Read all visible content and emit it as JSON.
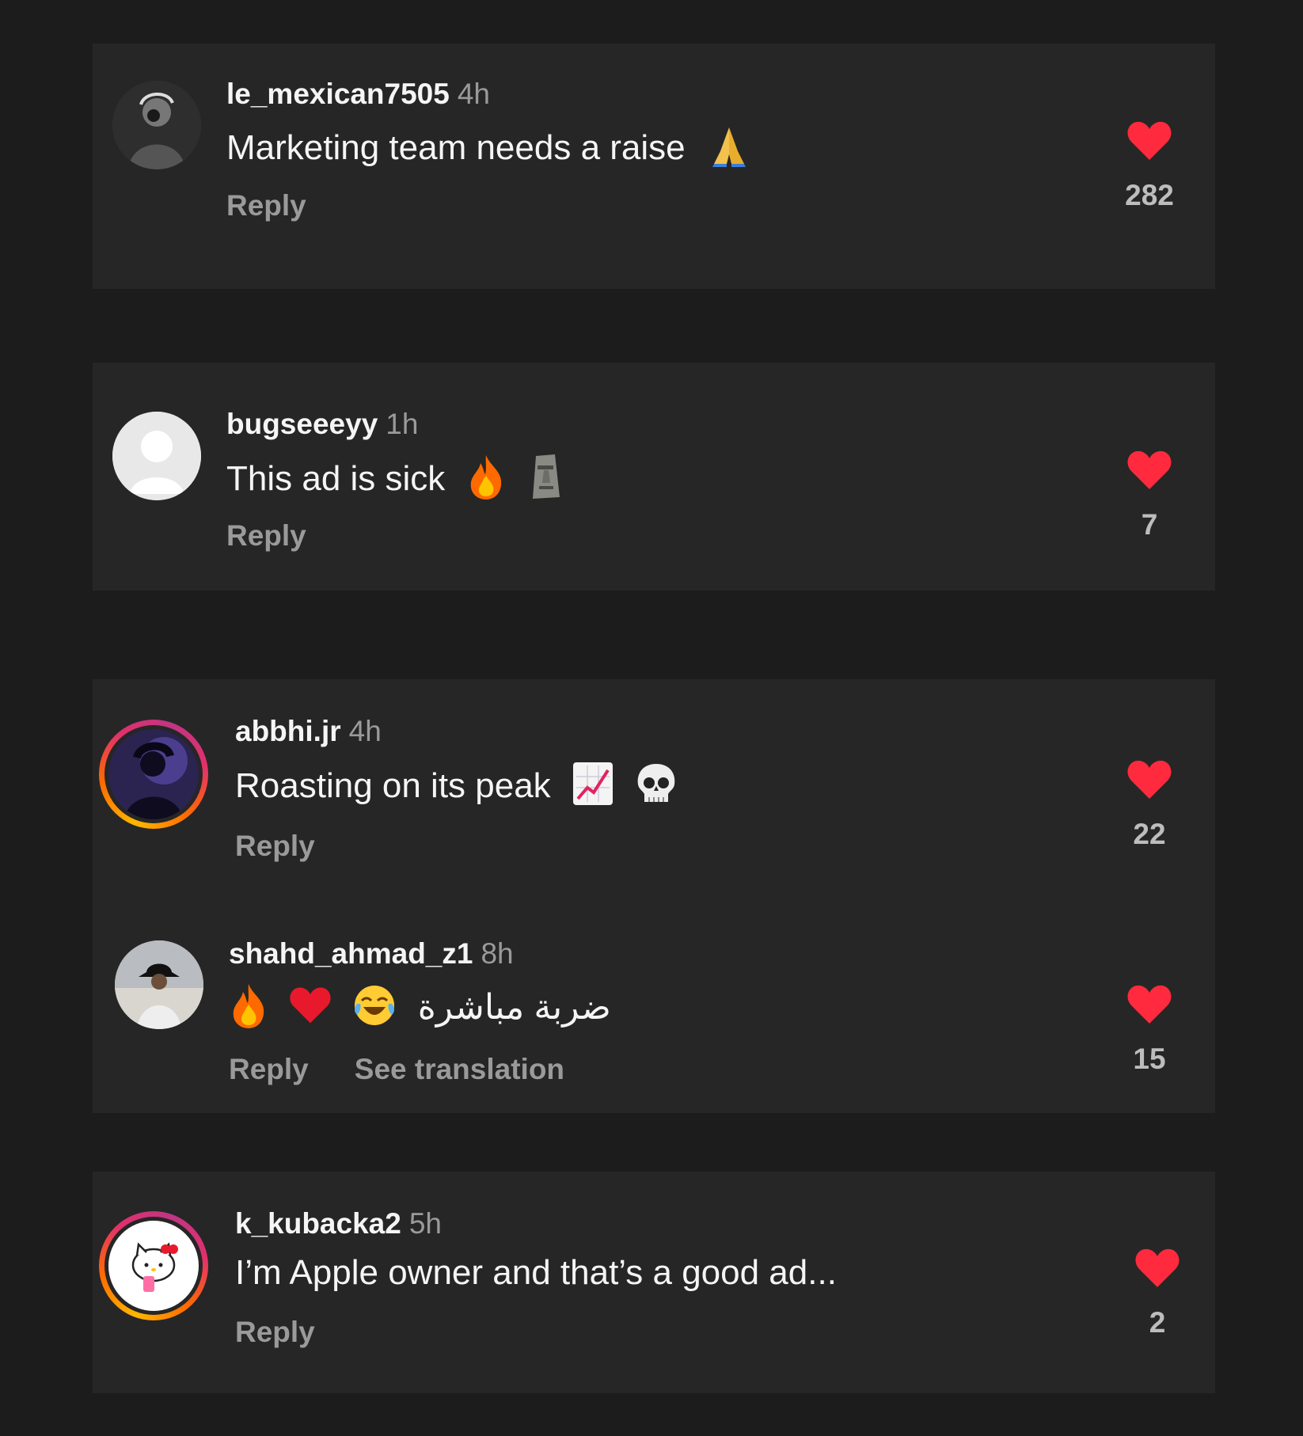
{
  "colors": {
    "background": "#1c1c1c",
    "card": "#262626",
    "heart": "#ff2a3d",
    "muted": "#9a9a9a"
  },
  "comments": [
    {
      "username": "le_mexican7505",
      "time": "4h",
      "text": "Marketing team needs a raise",
      "emojis": [
        "folded-hands"
      ],
      "reply": "Reply",
      "likes": "282",
      "avatar": "photo-dark-person",
      "ring": false
    },
    {
      "username": "bugseeeyy",
      "time": "1h",
      "text": "This ad is sick",
      "emojis": [
        "fire",
        "moai"
      ],
      "reply": "Reply",
      "likes": "7",
      "avatar": "default-silhouette",
      "ring": false
    },
    {
      "username": "abbhi.jr",
      "time": "4h",
      "text": "Roasting on its peak",
      "emojis": [
        "chart-increasing",
        "skull"
      ],
      "reply": "Reply",
      "likes": "22",
      "avatar": "photo-purple-person",
      "ring": true
    },
    {
      "username": "shahd_ahmad_z1",
      "time": "8h",
      "text": "ضربة مباشرة",
      "emojis": [
        "fire",
        "red-heart",
        "face-with-tears-of-joy"
      ],
      "reply": "Reply",
      "see_translation": "See translation",
      "likes": "15",
      "avatar": "photo-bucket-hat",
      "ring": false
    },
    {
      "username": "k_kubacka2",
      "time": "5h",
      "text": "I’m Apple owner and that’s a good ad...",
      "emojis": [],
      "reply": "Reply",
      "likes": "2",
      "avatar": "hello-kitty",
      "ring": true
    }
  ]
}
